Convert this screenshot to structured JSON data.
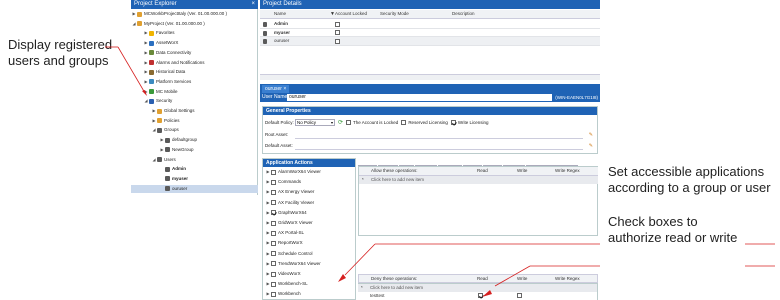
{
  "callouts": {
    "left": "Display registered users and groups",
    "right_top": "Set accessible applications according to a group or user",
    "right_bottom": "Check boxes to authorize read or write"
  },
  "explorer": {
    "title": "Project Explorer",
    "close": "×",
    "items": [
      {
        "label": "MCWorkbProjectItaly (Ver. 01.00.000.00 )",
        "icon": "project-icon",
        "color": "#e0a030"
      },
      {
        "label": "MyProject (Ver. 01.00.000.00 )",
        "icon": "project-icon",
        "color": "#e0a030"
      },
      {
        "label": "Favorites",
        "icon": "star-icon",
        "color": "#f0b400"
      },
      {
        "label": "AssetWorX",
        "icon": "asset-icon",
        "color": "#2a6fc0"
      },
      {
        "label": "Data Connectivity",
        "icon": "connectivity-icon",
        "color": "#6a8a3a"
      },
      {
        "label": "Alarms and Notifications",
        "icon": "alarm-icon",
        "color": "#c03030"
      },
      {
        "label": "Historical Data",
        "icon": "historical-icon",
        "color": "#8a6a30"
      },
      {
        "label": "Platform Services",
        "icon": "platform-icon",
        "color": "#3a8ac0"
      },
      {
        "label": "MC Mobile",
        "icon": "mobile-icon",
        "color": "#3a9a3a"
      },
      {
        "label": "Security",
        "icon": "security-icon",
        "color": "#2a5fb0"
      },
      {
        "label": "Global Settings",
        "icon": "settings-icon",
        "color": "#e0a030"
      },
      {
        "label": "Policies",
        "icon": "policy-icon",
        "color": "#e0a030"
      },
      {
        "label": "Groups",
        "icon": "groups-icon",
        "color": "#5a5a5a"
      },
      {
        "label": "defaultgroup",
        "icon": "group-icon",
        "color": "#5a5a5a"
      },
      {
        "label": "NewGroup",
        "icon": "group-icon",
        "color": "#5a5a5a"
      },
      {
        "label": "Users",
        "icon": "users-icon",
        "color": "#5a5a5a"
      },
      {
        "label": "Admin",
        "icon": "user-icon",
        "color": "#5a5a5a"
      },
      {
        "label": "myuser",
        "icon": "user-icon",
        "color": "#5a5a5a"
      },
      {
        "label": "ouruser",
        "icon": "user-icon",
        "color": "#5a5a5a"
      }
    ]
  },
  "details": {
    "title": "Project Details",
    "columns": [
      "Name",
      "Account Locked",
      "Security Mode",
      "Description"
    ],
    "rows": [
      "Admin",
      "myuser",
      "ouruser"
    ]
  },
  "user_tab": {
    "tab_label": "ouruser",
    "tab_close": "×",
    "username_label": "User Name:",
    "username_value": "ouruser",
    "username_domain": "(WIN-EAEN0L7G1I8)"
  },
  "general": {
    "title": "General Properties",
    "default_policy_label": "Default Policy:",
    "default_policy_value": "No Policy",
    "locked_label": "The Account is Locked",
    "reserved_label": "Reserved Licensing",
    "write_label": "Write Licensing",
    "root_asset_label": "Root Asset:",
    "default_asset_label": "Default Asset:"
  },
  "apps": {
    "title": "Application Actions",
    "items": [
      {
        "label": "AlarmWorX64 Viewer",
        "checked": false
      },
      {
        "label": "Commands",
        "checked": false
      },
      {
        "label": "AX Energy Viewer",
        "checked": false
      },
      {
        "label": "AX Facility Viewer",
        "checked": false
      },
      {
        "label": "GraphWorX64",
        "checked": true
      },
      {
        "label": "GridWorX Viewer",
        "checked": false
      },
      {
        "label": "AX Portal-SL",
        "checked": false
      },
      {
        "label": "ReportWorX",
        "checked": false
      },
      {
        "label": "Schedule Control",
        "checked": false
      },
      {
        "label": "TrendWorX64 Viewer",
        "checked": false
      },
      {
        "label": "VideoWorX",
        "checked": false
      },
      {
        "label": "Workbench-SL",
        "checked": false
      },
      {
        "label": "Workbench",
        "checked": false
      }
    ]
  },
  "points": {
    "tabs": [
      "Points",
      "Alarms",
      "Files",
      "Stations",
      "Methods",
      "Assets",
      "Mobile",
      "Custom",
      "EarthWorX Credentials"
    ],
    "allow_header": "Allow these operations:",
    "deny_header": "Deny these operations:",
    "col_read": "Read",
    "col_write": "Write",
    "col_write_regex": "Write Regex",
    "add_item": "Click here to add new item",
    "deny_row": {
      "name": "testtest",
      "read": true,
      "write": false
    }
  },
  "colors": {
    "accent": "#1f63b5",
    "callout_line": "#d62020"
  }
}
